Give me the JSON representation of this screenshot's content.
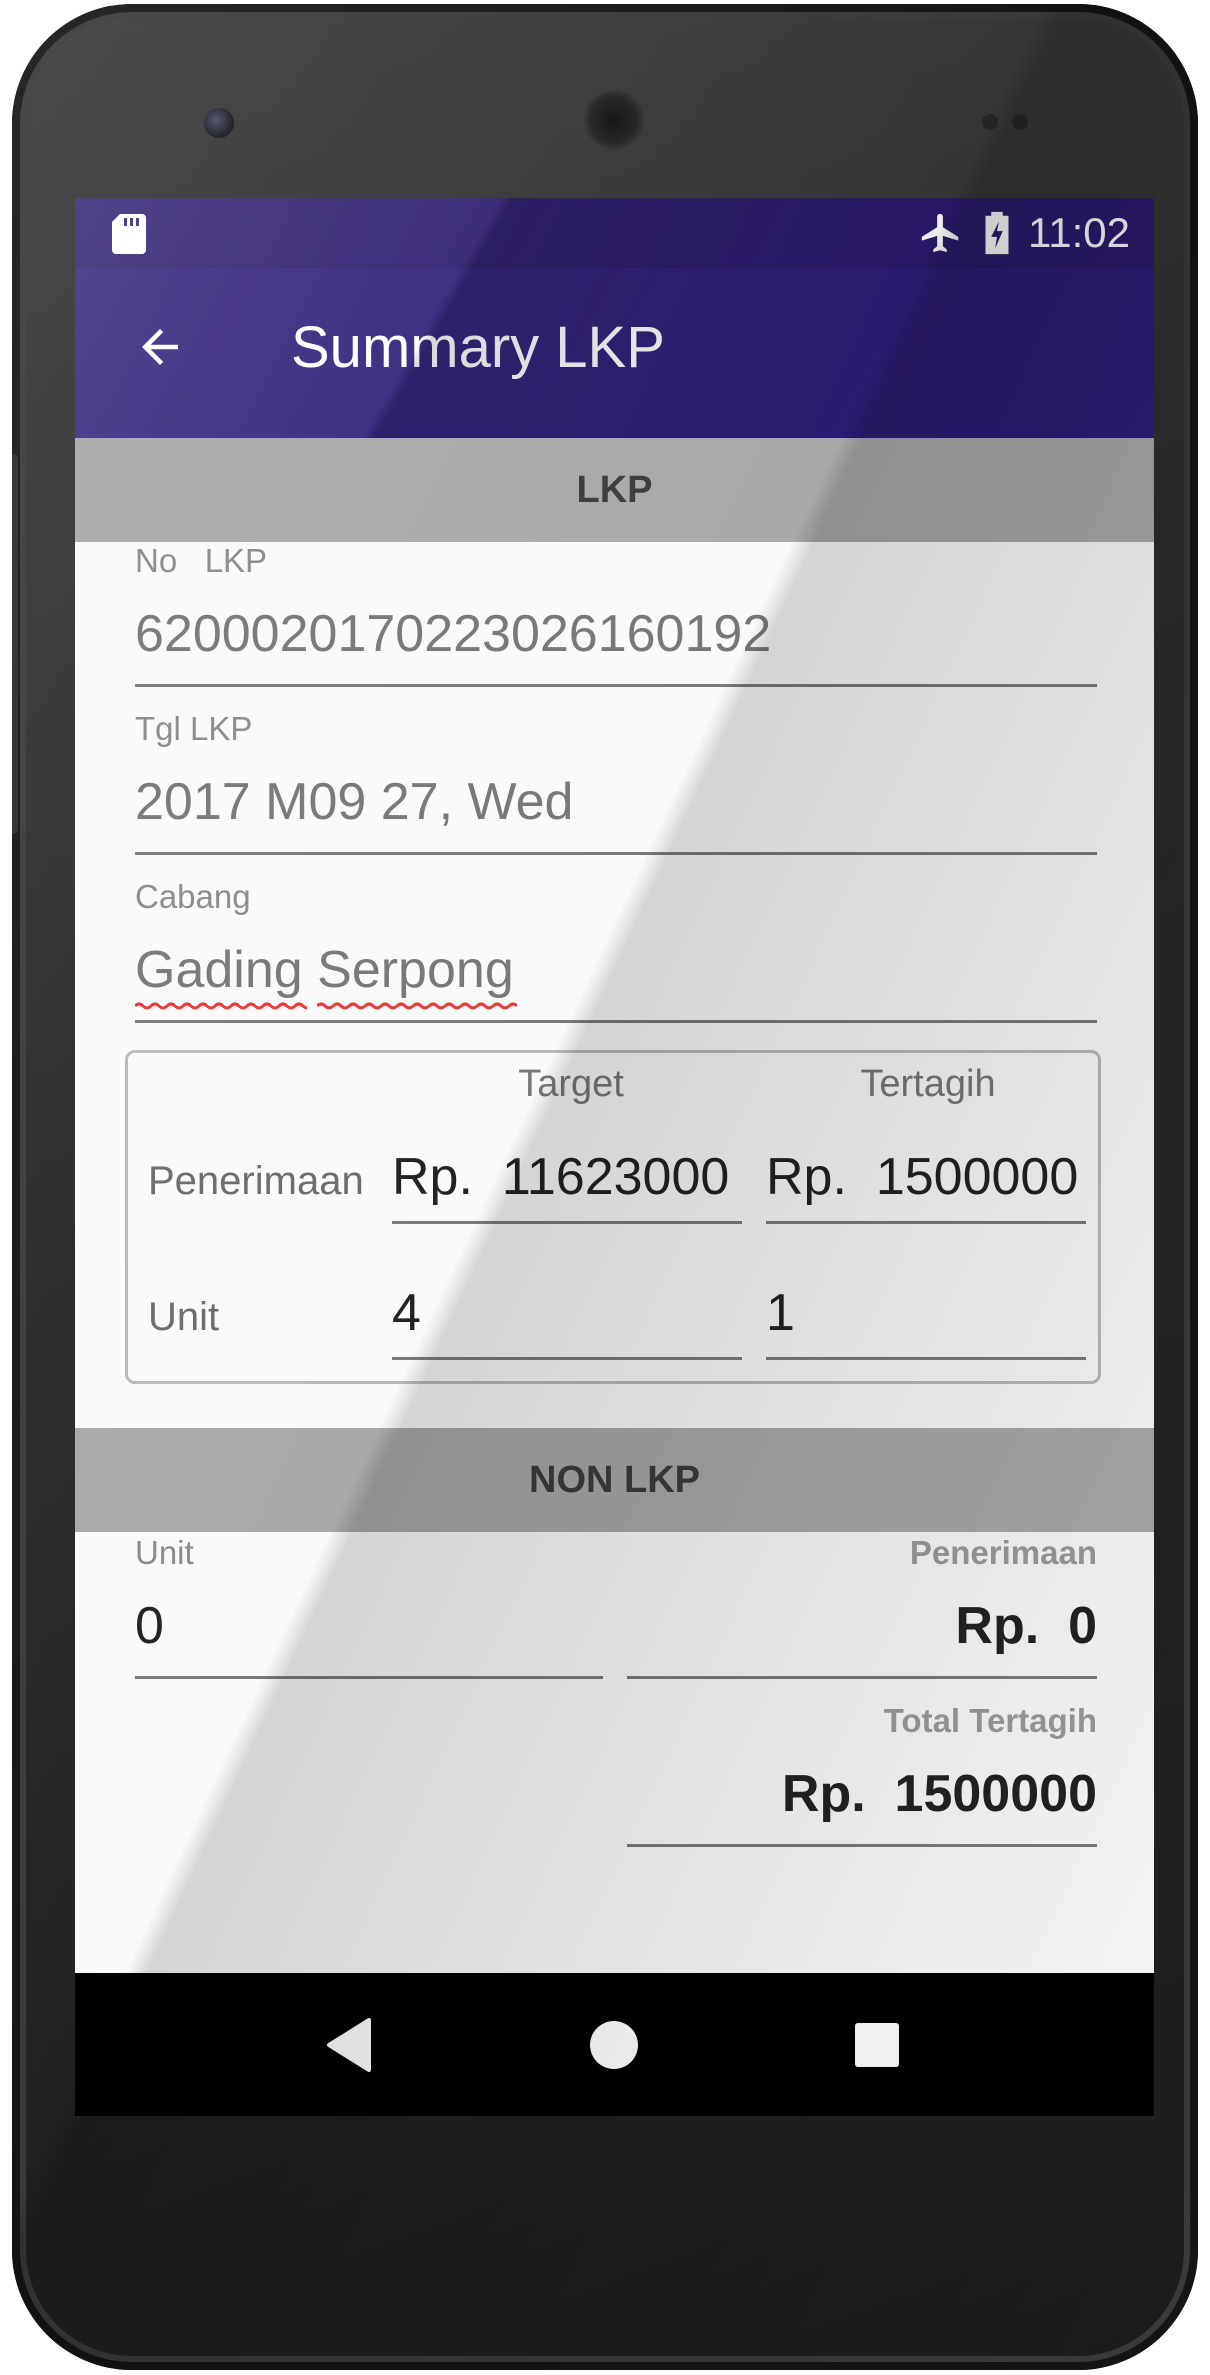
{
  "status_bar": {
    "time": "11:02",
    "icons": [
      "sd-card-icon",
      "airplane-icon",
      "battery-charging-icon"
    ]
  },
  "app_bar": {
    "title": "Summary LKP",
    "back_icon": "arrow-left-icon"
  },
  "lkp_section": {
    "header": "LKP",
    "no_lkp": {
      "label": "No   LKP",
      "value": "620002017022302616 0192"
    },
    "tgl_lkp": {
      "label": "Tgl LKP",
      "value": "2017 M09 27, Wed"
    },
    "cabang": {
      "label": "Cabang",
      "value_part1": "Gading",
      "value_part2": "Serpong"
    },
    "table": {
      "col_target": "Target",
      "col_tertagih": "Tertagih",
      "rows": [
        {
          "label": "Penerimaan",
          "target": "Rp.  11623000",
          "tertagih": "Rp.  1500000"
        },
        {
          "label": "Unit",
          "target": "4",
          "tertagih": "1"
        }
      ]
    }
  },
  "non_lkp_section": {
    "header": "NON LKP",
    "unit": {
      "label": "Unit",
      "value": "0"
    },
    "penerimaan": {
      "label": "Penerimaan",
      "value": "Rp.  0"
    },
    "total_tertagih": {
      "label": "Total Tertagih",
      "value": "Rp.  1500000"
    }
  },
  "nav_bar": {
    "icons": [
      "back-triangle-icon",
      "home-circle-icon",
      "recents-square-icon"
    ]
  },
  "colors": {
    "app_bar": "#2e1d78",
    "status_bar": "#2b1a6e",
    "section_header": "#a9a9a9",
    "spellcheck": "#e53935"
  }
}
